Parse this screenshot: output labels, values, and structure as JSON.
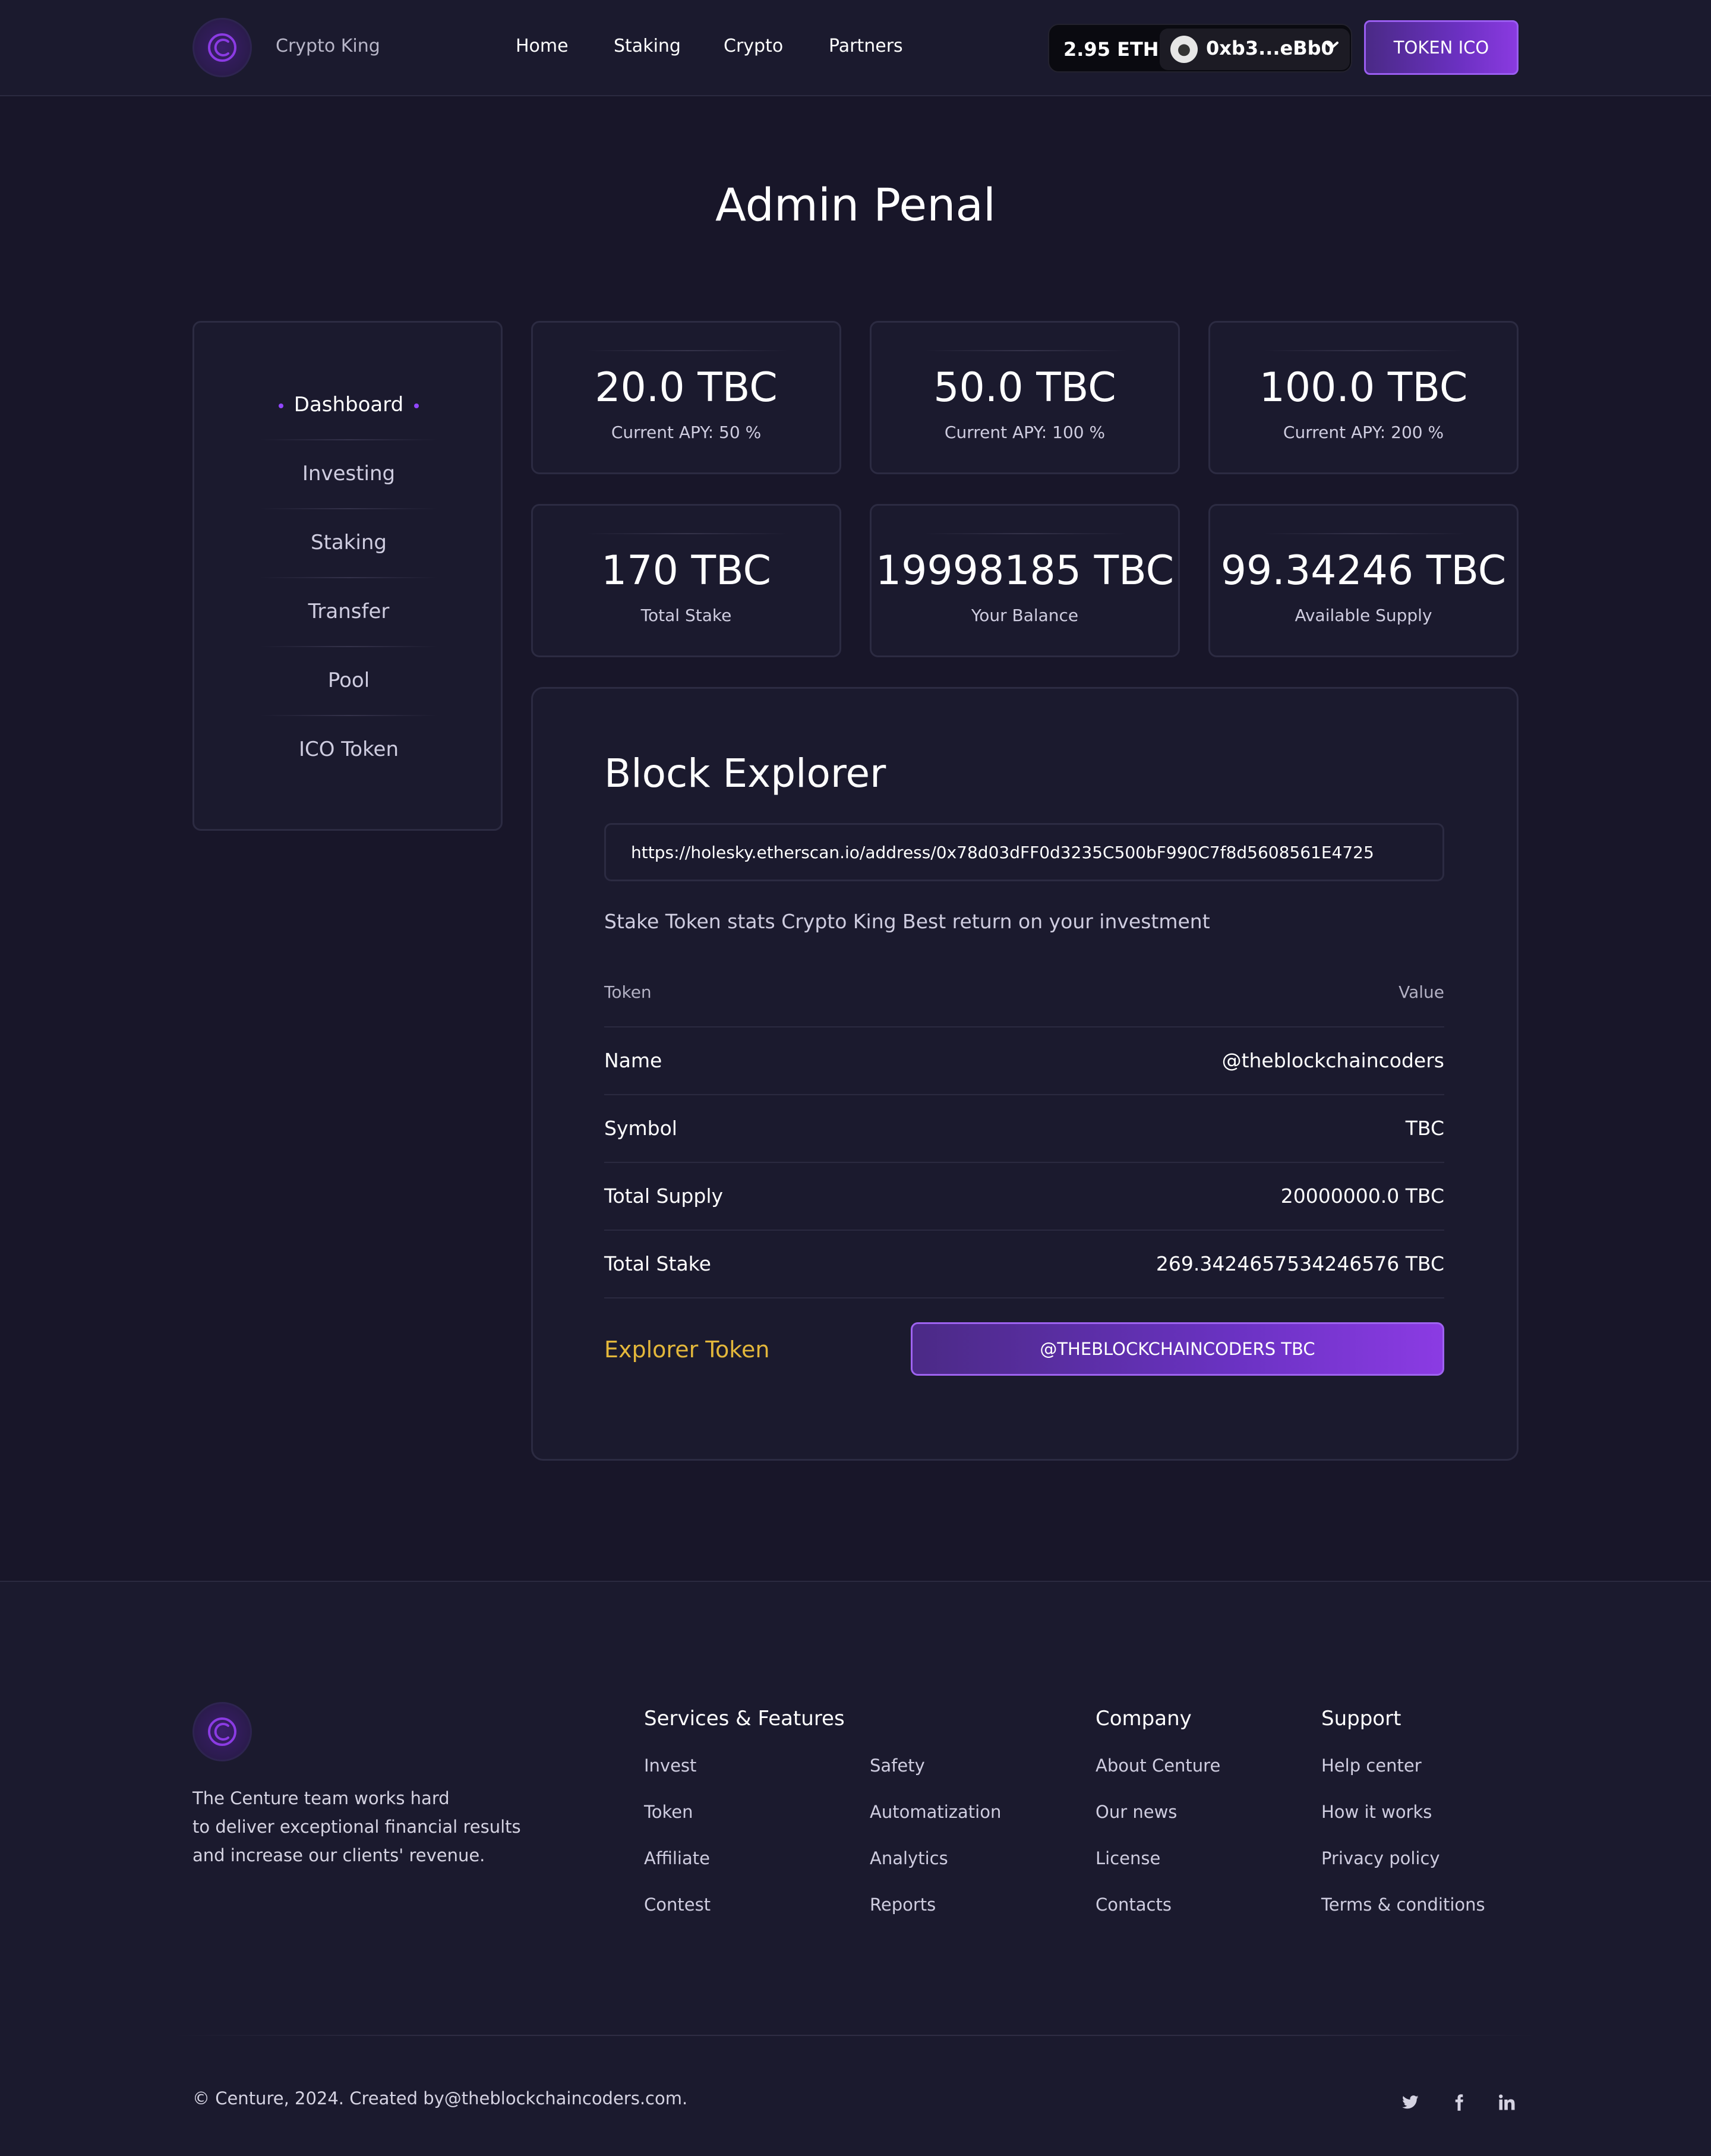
{
  "header": {
    "brand_name": "Crypto King",
    "nav": [
      "Home",
      "Staking",
      "Crypto",
      "Partners"
    ],
    "wallet_balance": "2.95 ETH",
    "wallet_address": "0xb3...eBb0",
    "ico_button": "TOKEN ICO"
  },
  "page_title": "Admin Penal",
  "sidebar": {
    "items": [
      "Dashboard",
      "Investing",
      "Staking",
      "Transfer",
      "Pool",
      "ICO Token"
    ],
    "active": "Dashboard"
  },
  "stats": [
    {
      "value": "20.0 TBC",
      "label": "Current APY: 50 %"
    },
    {
      "value": "50.0 TBC",
      "label": "Current APY: 100 %"
    },
    {
      "value": "100.0 TBC",
      "label": "Current APY: 200 %"
    },
    {
      "value": "170 TBC",
      "label": "Total Stake"
    },
    {
      "value": "19998185 TBC",
      "label": "Your Balance"
    },
    {
      "value": "99.34246 TBC",
      "label": "Available Supply"
    }
  ],
  "explorer": {
    "title": "Block Explorer",
    "url": "https://holesky.etherscan.io/address/0x78d03dFF0d3235C500bF990C7f8d5608561E4725",
    "description": "Stake Token stats Crypto King Best return on your investment",
    "table_header": {
      "left": "Token",
      "right": "Value"
    },
    "rows": [
      {
        "label": "Name",
        "value": "@theblockchaincoders"
      },
      {
        "label": "Symbol",
        "value": "TBC"
      },
      {
        "label": "Total Supply",
        "value": "20000000.0 TBC"
      },
      {
        "label": "Total Stake",
        "value": "269.3424657534246576 TBC"
      }
    ],
    "token_label": "Explorer Token",
    "token_button": "@THEBLOCKCHAINCODERS TBC"
  },
  "footer": {
    "about_lines": [
      "The Centure team works hard",
      "to deliver exceptional financial results",
      "and increase our clients' revenue."
    ],
    "services": {
      "heading": "Services & Features",
      "col1": [
        "Invest",
        "Token",
        "Affiliate",
        "Contest"
      ],
      "col2": [
        "Safety",
        "Automatization",
        "Analytics",
        "Reports"
      ]
    },
    "company": {
      "heading": "Company",
      "links": [
        "About Centure",
        "Our news",
        "License",
        "Contacts"
      ]
    },
    "support": {
      "heading": "Support",
      "links": [
        "Help center",
        "How it works",
        "Privacy policy",
        "Terms & conditions"
      ]
    },
    "copyright": "© Centure, 2024. Created by@theblockchaincoders.com.",
    "social_icons": [
      "twitter-icon",
      "facebook-icon",
      "linkedin-icon"
    ]
  },
  "colors": {
    "background": "#181629",
    "card": "#1b1a2e",
    "accent_purple": "#8b3be3",
    "explorer_token_label": "#e3b73b"
  }
}
